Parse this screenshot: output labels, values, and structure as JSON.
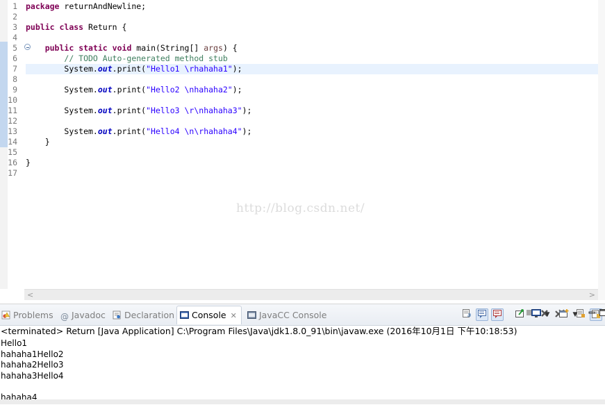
{
  "editor": {
    "line_numbers": [
      "1",
      "2",
      "3",
      "4",
      "5",
      "6",
      "7",
      "8",
      "9",
      "10",
      "11",
      "12",
      "13",
      "14",
      "15",
      "16",
      "17"
    ],
    "current_line": 7,
    "code": {
      "l1_kw": "package",
      "l1_rest": " returnAndNewline;",
      "l3_kw1": "public",
      "l3_kw2": "class",
      "l3_rest": " Return {",
      "l5_kw1": "public",
      "l5_kw2": "static",
      "l5_kw3": "void",
      "l5_rest": " main(String[] ",
      "l5_args": "args",
      "l5_end": ") {",
      "l6_comment": "// TODO Auto-generated method stub",
      "print_prefix": "System.",
      "print_field": "out",
      "print_method": ".print(",
      "print_end": ");",
      "l7_str": "\"Hello1 \\rhahaha1\"",
      "l9_str": "\"Hello2 \\nhahaha2\"",
      "l11_str": "\"Hello3 \\r\\nhahaha3\"",
      "l13_str": "\"Hello4 \\n\\rhahaha4\"",
      "l14": "}",
      "l16": "}"
    },
    "watermark": "http://blog.csdn.net/",
    "hscroll_left": "<",
    "hscroll_right": ">"
  },
  "view": {
    "tabs": [
      {
        "label": "Problems",
        "icon": "problems-icon"
      },
      {
        "label": "Javadoc",
        "icon": "at-icon"
      },
      {
        "label": "Declaration",
        "icon": "declaration-icon"
      },
      {
        "label": "Console",
        "icon": "console-icon",
        "active": true,
        "close": "✕"
      },
      {
        "label": "JavaCC Console",
        "icon": "javacc-console-icon"
      }
    ],
    "status": "<terminated> Return [Java Application] C:\\Program Files\\Java\\jdk1.8.0_91\\bin\\javaw.exe (2016年10月1日 下午10:18:53)",
    "output": [
      "Hello1",
      "hahaha1Hello2",
      "hahaha2Hello3",
      "hahaha3Hello4",
      "",
      "hahaha4"
    ],
    "toolbar_icons": [
      "terminate-icon",
      "remove-launch-icon",
      "remove-all-terminated-icon",
      "clear-console-icon",
      "scroll-lock-icon",
      "word-wrap-icon",
      "show-on-stdout-icon",
      "show-on-stderr-icon",
      "pin-console-icon",
      "display-console-icon",
      "display-console-dropdown-icon",
      "open-console-icon",
      "open-console-dropdown-icon",
      "minimize-icon",
      "maximize-icon"
    ]
  },
  "colors": {
    "keyword": "#7f0055",
    "comment": "#3f7f5f",
    "string": "#2a00ff",
    "field": "#0000c0",
    "current_line": "#e8f2fe"
  }
}
